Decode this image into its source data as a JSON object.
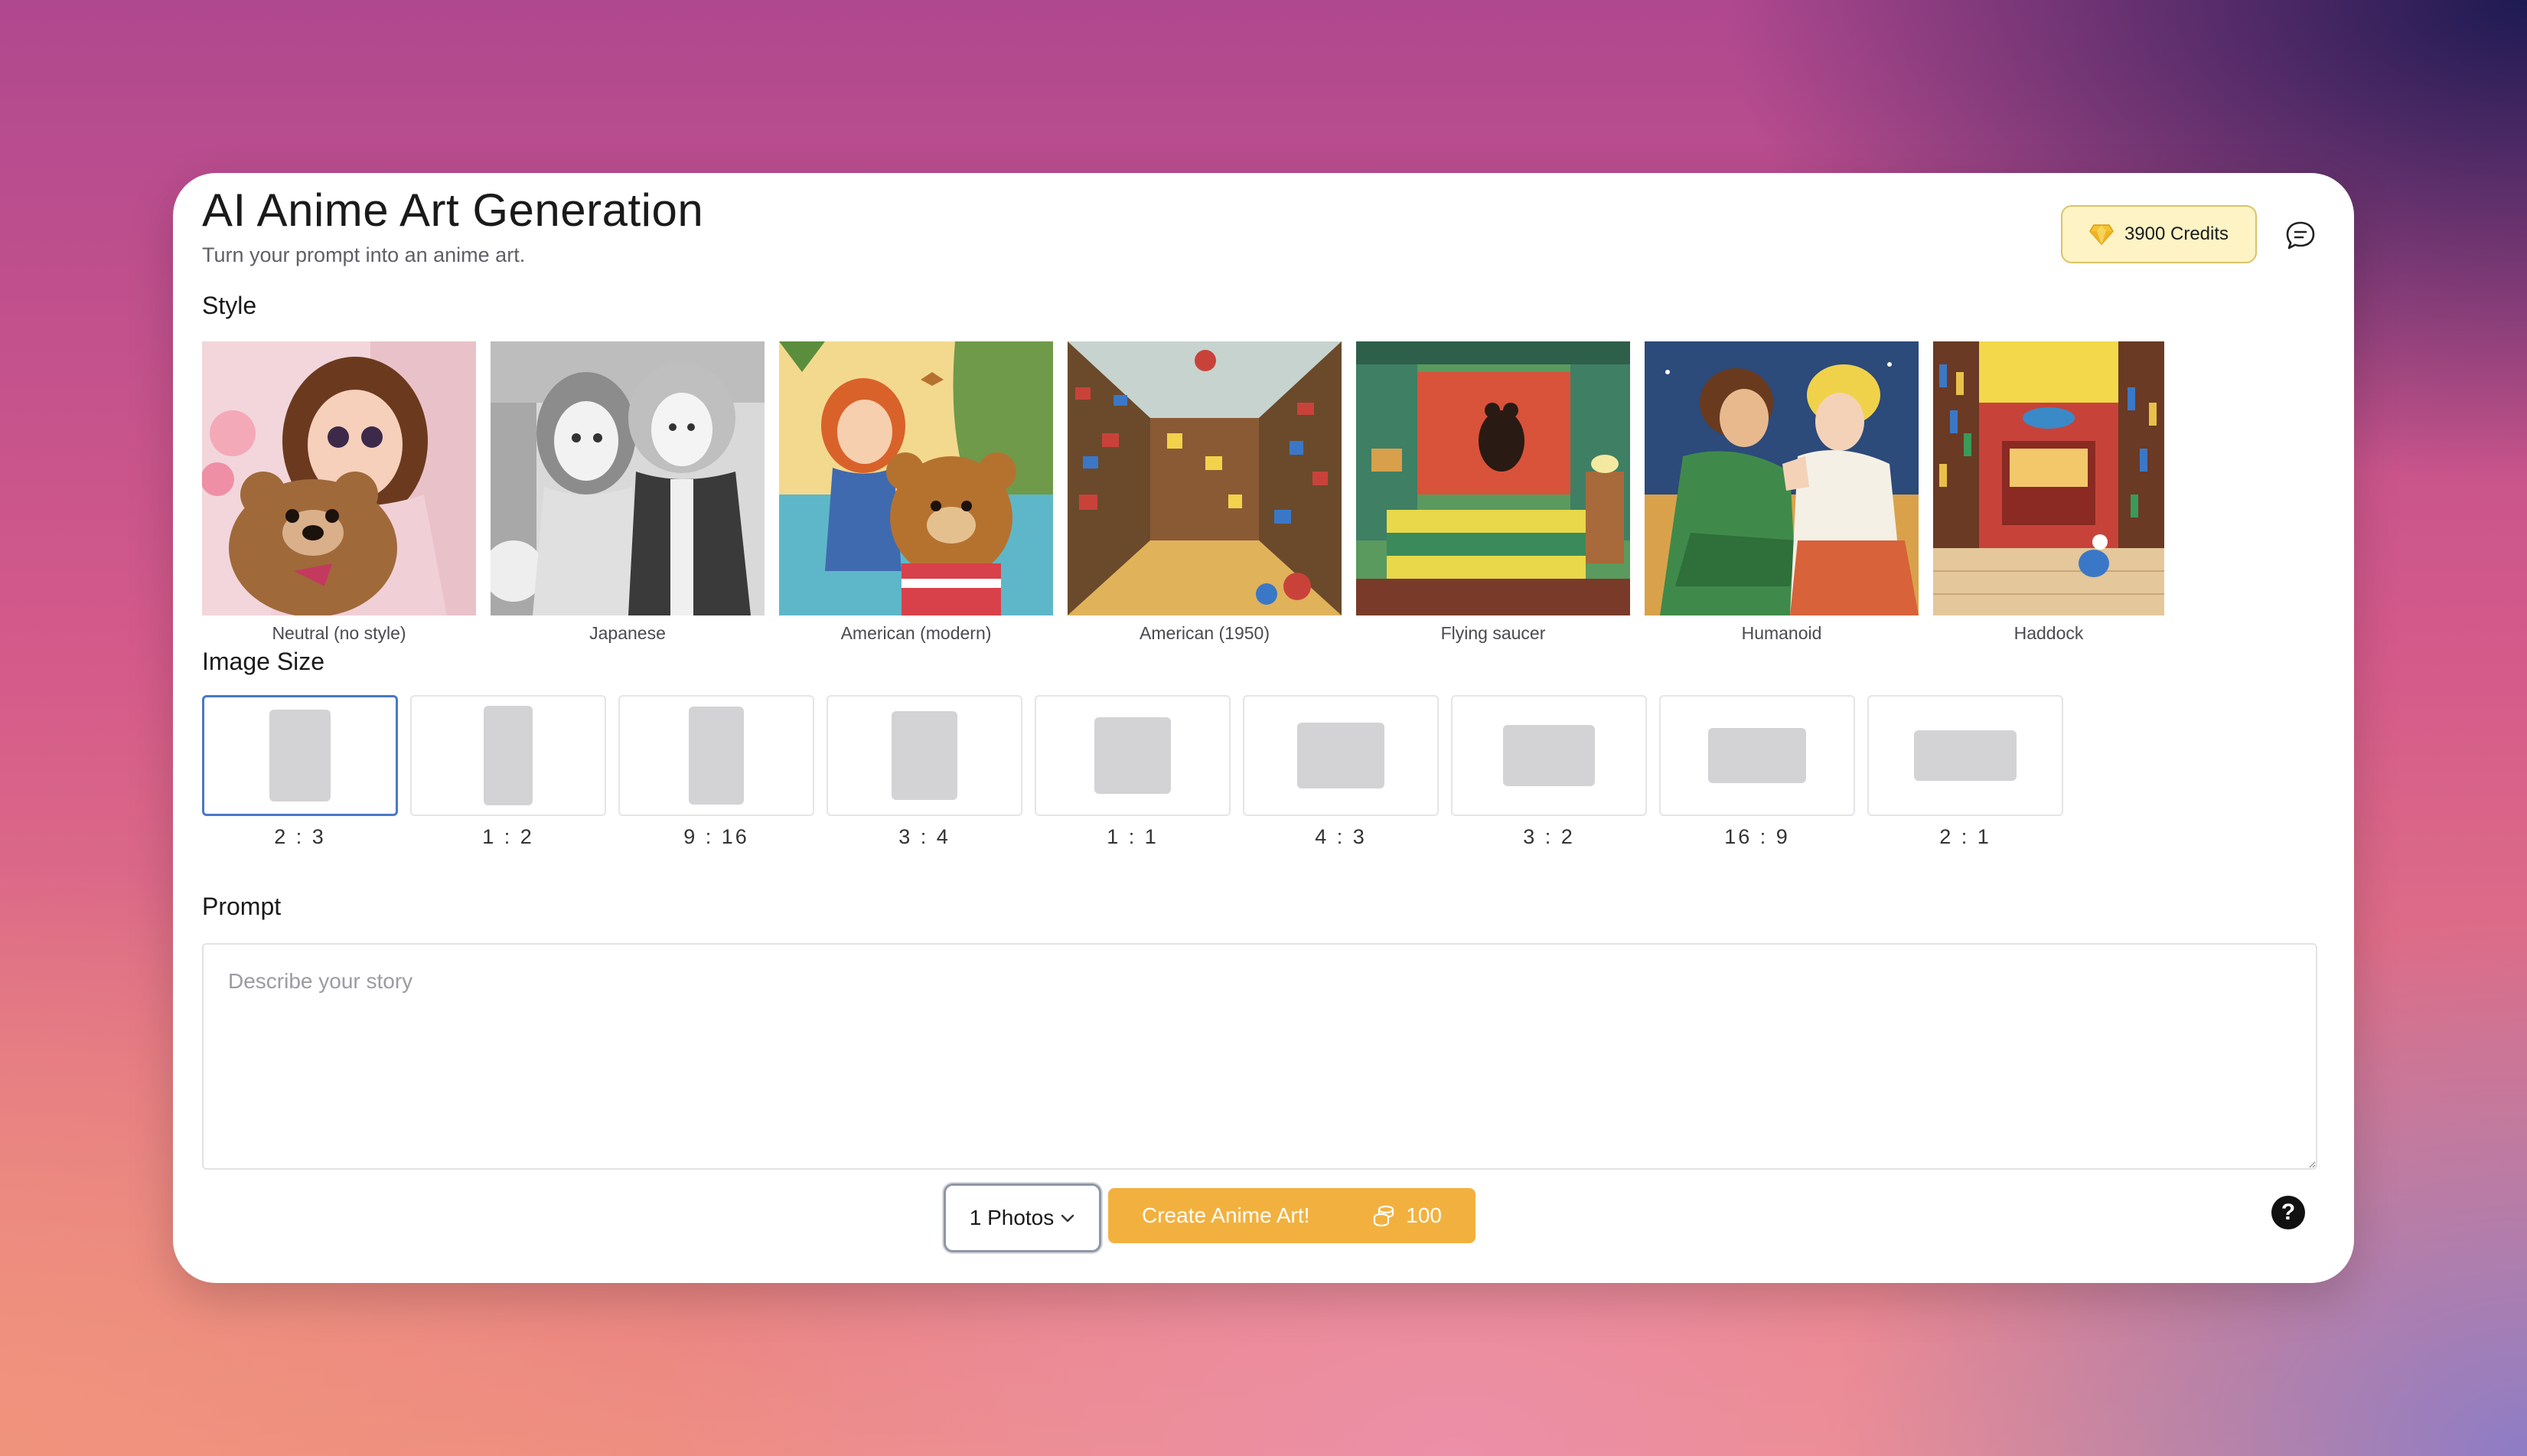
{
  "header": {
    "title": "AI Anime Art Generation",
    "subtitle": "Turn your prompt into an anime art.",
    "credits_label": "3900 Credits",
    "credits_icon": "gem-icon",
    "feedback_icon": "chat-bubble-icon"
  },
  "style_section": {
    "label": "Style",
    "items": [
      {
        "label": "Neutral (no style)"
      },
      {
        "label": "Japanese"
      },
      {
        "label": "American (modern)"
      },
      {
        "label": "American (1950)"
      },
      {
        "label": "Flying saucer"
      },
      {
        "label": "Humanoid"
      },
      {
        "label": "Haddock"
      }
    ]
  },
  "size_section": {
    "label": "Image Size",
    "selected": "2 : 3",
    "items": [
      {
        "label": "2 : 3"
      },
      {
        "label": "1 : 2"
      },
      {
        "label": "9 : 16"
      },
      {
        "label": "3 : 4"
      },
      {
        "label": "1 : 1"
      },
      {
        "label": "4 : 3"
      },
      {
        "label": "3 : 2"
      },
      {
        "label": "16 : 9"
      },
      {
        "label": "2 : 1"
      }
    ]
  },
  "prompt_section": {
    "label": "Prompt",
    "placeholder": "Describe your story",
    "value": ""
  },
  "footer": {
    "photos_value": "1 Photos",
    "create_label": "Create Anime Art!",
    "cost": "100",
    "cost_icon": "coins-icon",
    "help_icon": "help-icon"
  },
  "colors": {
    "accent": "#f2b13f",
    "credits_bg": "#fdf3c4",
    "selected_border": "#4a78c7"
  }
}
